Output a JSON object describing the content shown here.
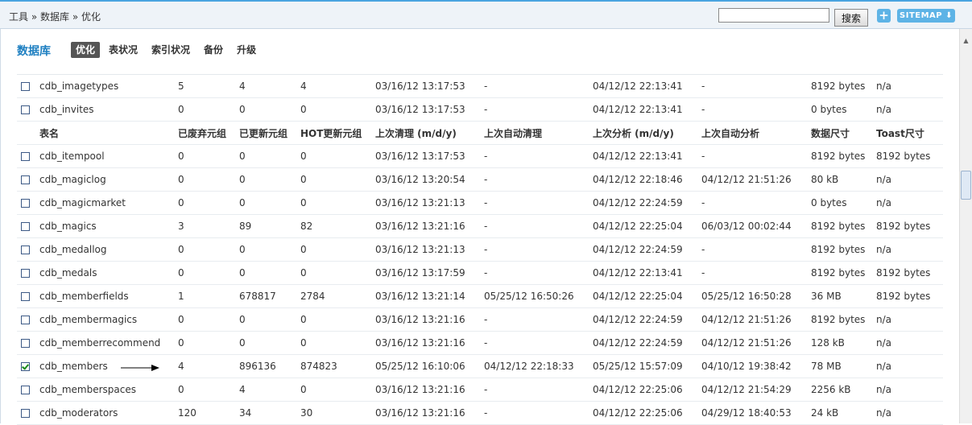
{
  "breadcrumb": [
    "工具",
    "»",
    "数据库",
    "»",
    "优化"
  ],
  "search": {
    "button_label": "搜索",
    "value": ""
  },
  "top_buttons": {
    "plus": "+",
    "sitemap": "SITEMAP ⬇"
  },
  "section_title": "数据库",
  "tabs": [
    "优化",
    "表状况",
    "索引状况",
    "备份",
    "升级"
  ],
  "active_tab": 0,
  "columns": [
    "表名",
    "已废弃元组",
    "已更新元组",
    "HOT更新元组",
    "上次清理 (m/d/y)",
    "上次自动清理",
    "上次分析 (m/d/y)",
    "上次自动分析",
    "数据尺寸",
    "Toast尺寸"
  ],
  "rows_before_header": [
    [
      "cdb_imagetypes",
      "5",
      "4",
      "4",
      "03/16/12 13:17:53",
      "-",
      "04/12/12 22:13:41",
      "-",
      "8192 bytes",
      "n/a"
    ],
    [
      "cdb_invites",
      "0",
      "0",
      "0",
      "03/16/12 13:17:53",
      "-",
      "04/12/12 22:13:41",
      "-",
      "0 bytes",
      "n/a"
    ]
  ],
  "rows_after_header": [
    [
      "cdb_itempool",
      "0",
      "0",
      "0",
      "03/16/12 13:17:53",
      "-",
      "04/12/12 22:13:41",
      "-",
      "8192 bytes",
      "8192 bytes"
    ],
    [
      "cdb_magiclog",
      "0",
      "0",
      "0",
      "03/16/12 13:20:54",
      "-",
      "04/12/12 22:18:46",
      "04/12/12 21:51:26",
      "80 kB",
      "n/a"
    ],
    [
      "cdb_magicmarket",
      "0",
      "0",
      "0",
      "03/16/12 13:21:13",
      "-",
      "04/12/12 22:24:59",
      "-",
      "0 bytes",
      "n/a"
    ],
    [
      "cdb_magics",
      "3",
      "89",
      "82",
      "03/16/12 13:21:16",
      "-",
      "04/12/12 22:25:04",
      "06/03/12 00:02:44",
      "8192 bytes",
      "8192 bytes"
    ],
    [
      "cdb_medallog",
      "0",
      "0",
      "0",
      "03/16/12 13:21:13",
      "-",
      "04/12/12 22:24:59",
      "-",
      "8192 bytes",
      "n/a"
    ],
    [
      "cdb_medals",
      "0",
      "0",
      "0",
      "03/16/12 13:17:59",
      "-",
      "04/12/12 22:13:41",
      "-",
      "8192 bytes",
      "8192 bytes"
    ],
    [
      "cdb_memberfields",
      "1",
      "678817",
      "2784",
      "03/16/12 13:21:14",
      "05/25/12 16:50:26",
      "04/12/12 22:25:04",
      "05/25/12 16:50:28",
      "36 MB",
      "8192 bytes"
    ],
    [
      "cdb_membermagics",
      "0",
      "0",
      "0",
      "03/16/12 13:21:16",
      "-",
      "04/12/12 22:24:59",
      "04/12/12 21:51:26",
      "8192 bytes",
      "n/a"
    ],
    [
      "cdb_memberrecommend",
      "0",
      "0",
      "0",
      "03/16/12 13:21:16",
      "-",
      "04/12/12 22:24:59",
      "04/12/12 21:51:26",
      "128 kB",
      "n/a"
    ],
    [
      "cdb_members",
      "4",
      "896136",
      "874823",
      "05/25/12 16:10:06",
      "04/12/12 22:18:33",
      "05/25/12 15:57:09",
      "04/10/12 19:38:42",
      "78 MB",
      "n/a"
    ],
    [
      "cdb_memberspaces",
      "0",
      "4",
      "0",
      "03/16/12 13:21:16",
      "-",
      "04/12/12 22:25:06",
      "04/12/12 21:54:29",
      "2256 kB",
      "n/a"
    ],
    [
      "cdb_moderators",
      "120",
      "34",
      "30",
      "03/16/12 13:21:16",
      "-",
      "04/12/12 22:25:06",
      "04/29/12 18:40:53",
      "24 kB",
      "n/a"
    ]
  ],
  "checked_table": "cdb_members"
}
